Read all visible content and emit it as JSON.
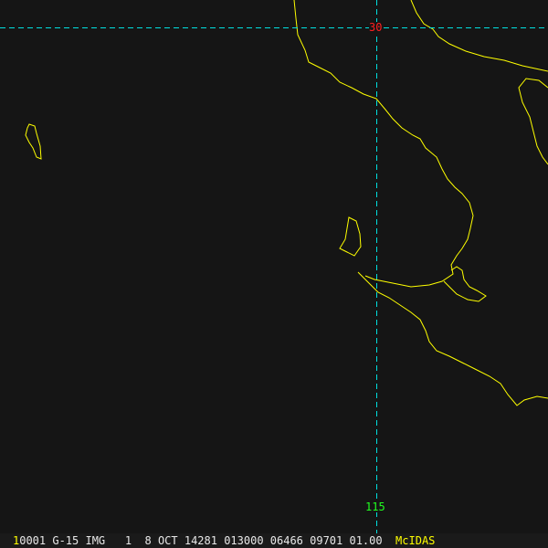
{
  "map": {
    "gridlines": {
      "latitude": "30",
      "longitude": "115"
    },
    "colors": {
      "coast": "#ffff00",
      "grid": "#00e0e0",
      "lat_label": "#ff2020",
      "lon_label": "#20ff20",
      "background": "#151515"
    }
  },
  "status_bar": {
    "frame": "1",
    "info": "0001 G-15 IMG   1  8 OCT 14281 013000 06466 09701 01.00",
    "brand": "McIDAS"
  }
}
